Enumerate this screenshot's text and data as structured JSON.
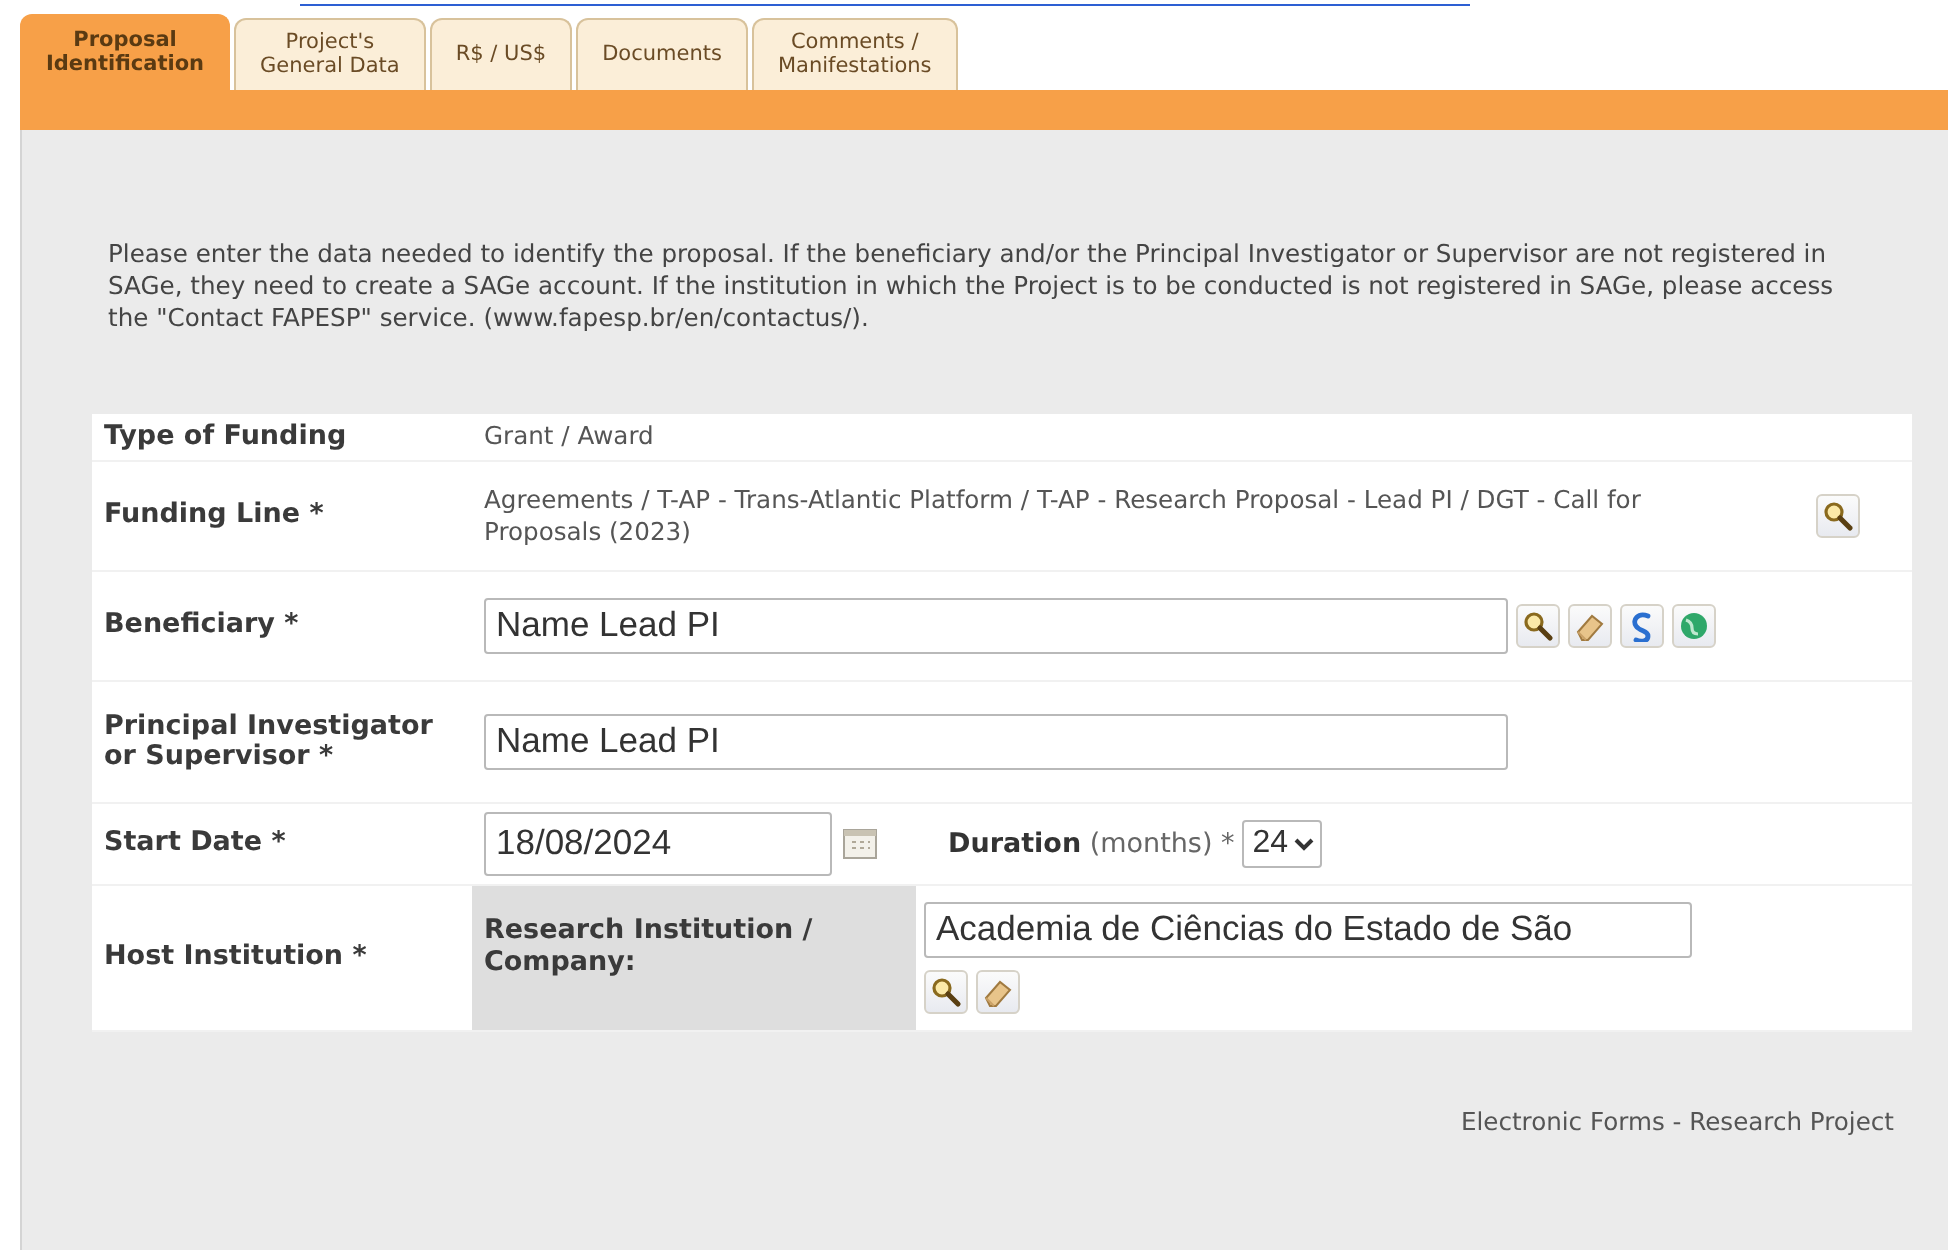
{
  "tabs": [
    {
      "label": "Proposal\nIdentification",
      "selected": true
    },
    {
      "label": "Project's\nGeneral Data",
      "selected": false
    },
    {
      "label": "R$ / US$",
      "selected": false
    },
    {
      "label": "Documents",
      "selected": false
    },
    {
      "label": "Comments /\nManifestations",
      "selected": false
    }
  ],
  "intro": "Please enter the data needed to identify the proposal. If the beneficiary and/or the Principal Investigator or Supervisor are not registered in SAGe, they need to create a SAGe account. If the institution in which the Project is to be conducted is not registered in SAGe, please access the \"Contact FAPESP\" service. (www.fapesp.br/en/contactus/).",
  "form": {
    "rows": [
      {
        "kind": "text",
        "label": "Type of Funding",
        "value": "Grant / Award"
      },
      {
        "kind": "lookup-text",
        "label": "Funding Line *",
        "value": "Agreements / T-AP - Trans-Atlantic Platform / T-AP - Research Proposal - Lead PI / DGT - Call for Proposals (2023)"
      },
      {
        "kind": "person",
        "label": "Beneficiary *",
        "value": "Name Lead PI",
        "actions": true
      },
      {
        "kind": "person",
        "label": "Principal Investigator or Supervisor *",
        "value": "Name Lead PI",
        "actions": false
      },
      {
        "kind": "date",
        "label": "Start Date *",
        "value": "18/08/2024",
        "duration_label": "**Duration** (months) *",
        "duration_value": "24"
      },
      {
        "kind": "institution",
        "label": "Host Institution *",
        "sublabel": "Research Institution / Company:",
        "value": "Academia de Ciências do Estado de São"
      }
    ]
  },
  "footer": "Electronic Forms - Research Project"
}
